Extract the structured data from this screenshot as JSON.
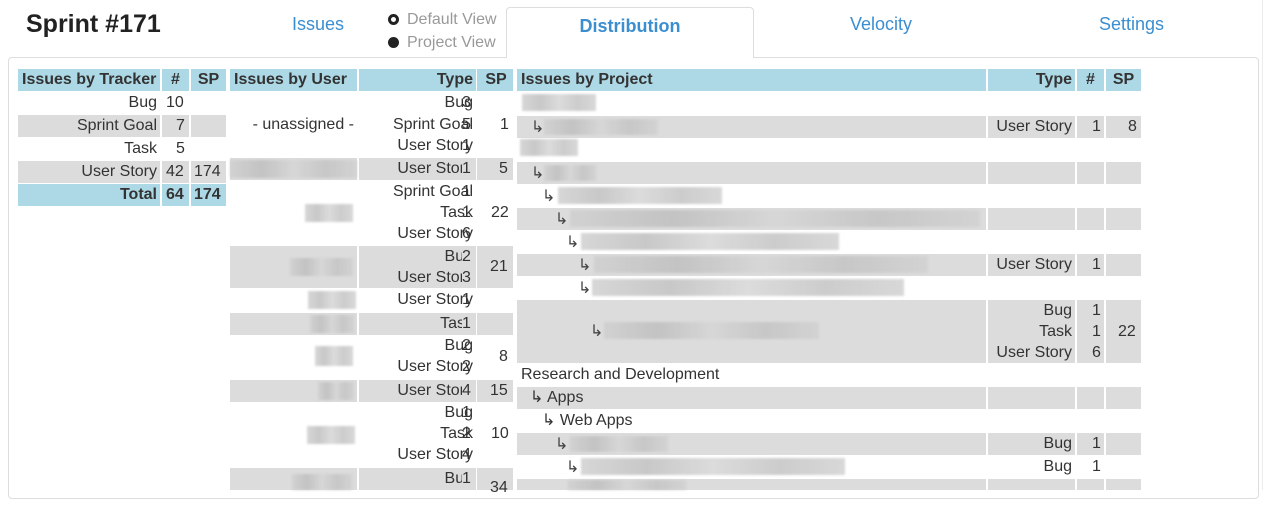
{
  "title": "Sprint #171",
  "tabs": {
    "issues": "Issues",
    "distribution": "Distribution",
    "velocity": "Velocity",
    "settings": "Settings"
  },
  "view_mode": {
    "default": "Default View",
    "project": "Project View",
    "selected": "Default View"
  },
  "tracker_table": {
    "headers": [
      "Issues by Tracker",
      "#",
      "SP"
    ],
    "rows": [
      {
        "tracker": "Bug",
        "count": "10",
        "sp": ""
      },
      {
        "tracker": "Sprint Goal",
        "count": "7",
        "sp": ""
      },
      {
        "tracker": "Task",
        "count": "5",
        "sp": ""
      },
      {
        "tracker": "User Story",
        "count": "42",
        "sp": "174"
      }
    ],
    "total": {
      "label": "Total",
      "count": "64",
      "sp": "174"
    }
  },
  "user_table": {
    "headers": [
      "Issues by User",
      "Type",
      "#",
      "SP"
    ],
    "rows": [
      {
        "type": "Bug",
        "count": "3",
        "sp": ""
      },
      {
        "user": "- unassigned -",
        "type": "Sprint Goal",
        "count": "5",
        "sp": "1"
      },
      {
        "type": "User Story",
        "count": "1",
        "sp": ""
      },
      {
        "type": "User Story",
        "count": "1",
        "sp": "5"
      },
      {
        "type": "Sprint Goal",
        "count": "1",
        "sp": ""
      },
      {
        "type": "Task",
        "count": "1",
        "sp": "22"
      },
      {
        "type": "User Story",
        "count": "6",
        "sp": ""
      },
      {
        "type": "Bug",
        "count": "2",
        "sp": ""
      },
      {
        "type": "User Story",
        "count": "3",
        "sp": "21"
      },
      {
        "type": "User Story",
        "count": "1",
        "sp": ""
      },
      {
        "type": "Task",
        "count": "1",
        "sp": ""
      },
      {
        "type": "Bug",
        "count": "2",
        "sp": ""
      },
      {
        "type": "User Story",
        "count": "2",
        "sp": "8"
      },
      {
        "type": "User Story",
        "count": "4",
        "sp": "15"
      },
      {
        "type": "Bug",
        "count": "1",
        "sp": ""
      },
      {
        "type": "Task",
        "count": "2",
        "sp": "10"
      },
      {
        "type": "User Story",
        "count": "4",
        "sp": ""
      },
      {
        "type": "Bug",
        "count": "1",
        "sp": "34"
      }
    ]
  },
  "project_table": {
    "headers": [
      "Issues by Project",
      "Type",
      "#",
      "SP"
    ],
    "rows": [
      {
        "type": "User Story",
        "count": "1",
        "sp": "8"
      },
      {
        "type": "User Story",
        "count": "1",
        "sp": ""
      },
      {
        "type": "Bug",
        "count": "1",
        "sp": ""
      },
      {
        "type": "Task",
        "count": "1",
        "sp": "22"
      },
      {
        "type": "User Story",
        "count": "6",
        "sp": ""
      },
      {
        "project": "Research and Development"
      },
      {
        "project": "Apps"
      },
      {
        "project": "Web Apps"
      },
      {
        "type": "Bug",
        "count": "1",
        "sp": ""
      },
      {
        "type": "Bug",
        "count": "1",
        "sp": ""
      }
    ]
  },
  "colors": {
    "header_bg": "#add8e6",
    "stripe_bg": "#dcdcdc",
    "link": "#3b8ed0"
  }
}
